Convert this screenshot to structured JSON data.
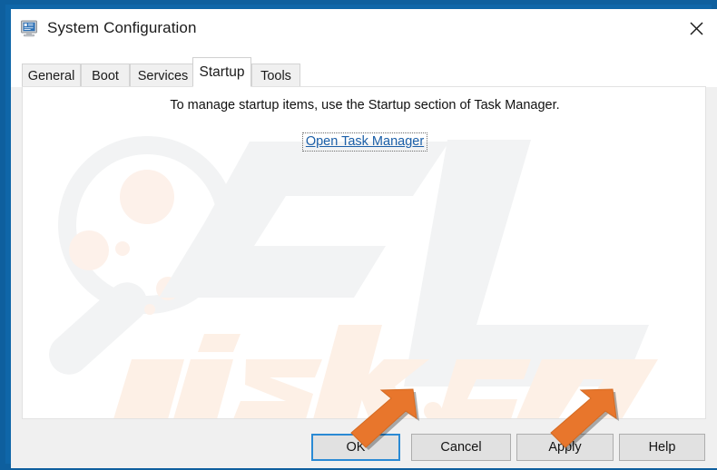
{
  "window": {
    "title": "System Configuration",
    "icon": "system-configuration-icon",
    "close_label": "✕",
    "border_color": "#0e5f9e",
    "titlebar_bg": "#ffffff"
  },
  "tabs": [
    {
      "label": "General",
      "active": false
    },
    {
      "label": "Boot",
      "active": false
    },
    {
      "label": "Services",
      "active": false
    },
    {
      "label": "Startup",
      "active": true
    },
    {
      "label": "Tools",
      "active": false
    }
  ],
  "content": {
    "info_text": "To manage startup items, use the Startup section of Task Manager.",
    "link_label": "Open Task Manager",
    "link_color": "#1b5fa8"
  },
  "watermark": {
    "text_primary": "PC",
    "text_secondary": "risk.com",
    "color_primary": "#f3f3f3",
    "color_secondary": "#fdf0e6"
  },
  "footer": {
    "buttons": [
      {
        "label": "OK",
        "default": true
      },
      {
        "label": "Cancel",
        "default": false
      },
      {
        "label": "Apply",
        "default": false
      },
      {
        "label": "Help",
        "default": false
      }
    ],
    "default_button_outline": "#2a8ad4"
  },
  "annotations": {
    "arrow_color": "#e8762c",
    "arrows": [
      {
        "name": "arrow-pointing-to-ok",
        "target": "OK"
      },
      {
        "name": "arrow-pointing-to-apply",
        "target": "Apply"
      }
    ]
  }
}
